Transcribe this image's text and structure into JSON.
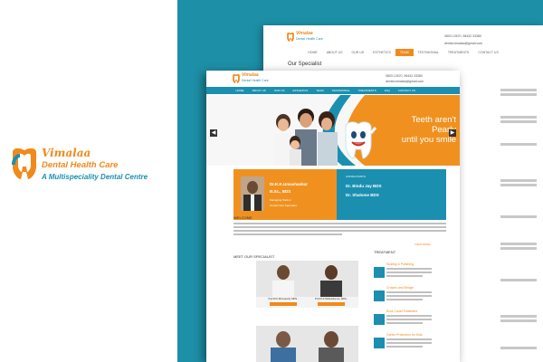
{
  "brand": {
    "name": "Vimalaa",
    "line2": "Dental Health Care",
    "line3": "A Multispeciality Dental Centre",
    "orange": "#f08a1c",
    "blue": "#1b8fb0"
  },
  "back_page": {
    "contact_phone": "0803 12670, 98432 33380",
    "contact_email": "dental.vimalaa@gmail.com",
    "nav": [
      "HOME",
      "ABOUT US",
      "OUR US",
      "ESTHETICS",
      "TEAM",
      "TESTIMONIAL",
      "TREATMENTS",
      "CONTACT US"
    ],
    "active_nav": "TEAM",
    "title": "Our Specialist"
  },
  "front_page": {
    "contact_phone": "0803 12670, 98432 33380",
    "contact_email": "dental.vimalaa@gmail.com",
    "nav": [
      "HOME",
      "ABOUT US",
      "OUR US",
      "ESTHETICS",
      "TEAM",
      "TESTIMONIAL",
      "TREATMENTS",
      "FAQ",
      "CONTACT US"
    ],
    "banner_text_1": "Teeth aren't Pearly",
    "banner_text_2": "until you smile",
    "doctor_main": "Dr.K.K.Umashankar",
    "doctor_main_degree": "B.Sc., BDS",
    "doctor_main_role": "Managing Partner",
    "doctor_main_sub": "Dental Care Specialist",
    "consultants_label": "CONSULTANTS",
    "consultant_1": "Dr. Bindu Jay BDS",
    "consultant_2": "Dr. Shalome BDS",
    "welcome_heading": "WELCOME",
    "read_more": "VIEW MORE",
    "meet_heading": "MEET OUR SPECIALIST",
    "treatment_heading": "TREATMENT",
    "specialists": [
      {
        "name": "Prof.Dr.K.Dhruvavelu, MDS.,"
      },
      {
        "name": "Prof.Dr.K.Mahendra ran, MDS.,"
      }
    ],
    "treatments": [
      "Scaling & Polishing",
      "Crowns and Bridge",
      "Root Canal Treatment",
      "Caries Protection for Kids"
    ]
  }
}
